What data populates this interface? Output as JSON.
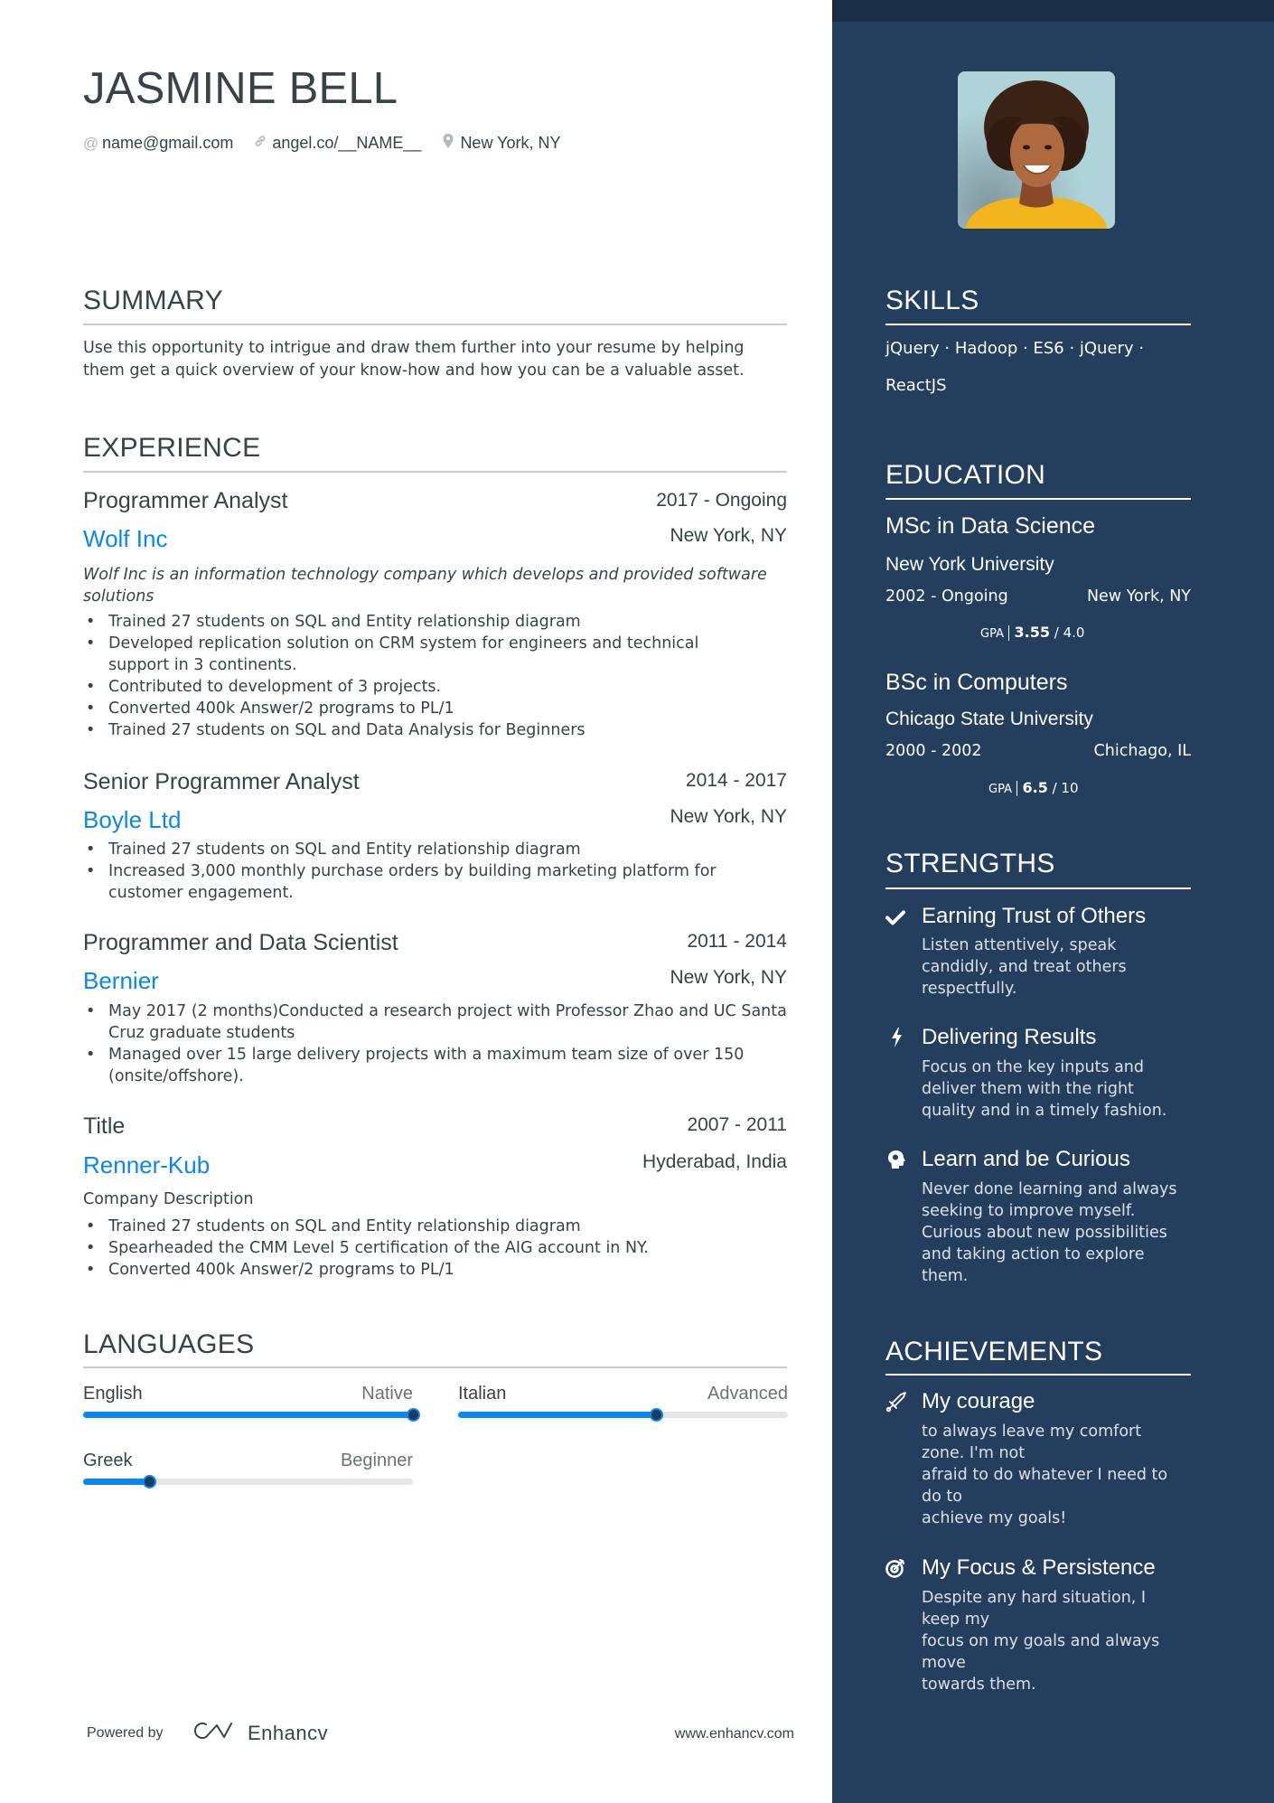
{
  "header": {
    "name": "JASMINE BELL",
    "contacts": [
      {
        "icon": "at-icon",
        "text": "name@gmail.com"
      },
      {
        "icon": "link-icon",
        "text": "angel.co/__NAME__"
      },
      {
        "icon": "location-pin-icon",
        "text": "New York, NY"
      }
    ]
  },
  "summary": {
    "title": "SUMMARY",
    "lines": [
      "Use this opportunity to intrigue and draw them further into your resume by helping",
      "them get a quick overview of your know-how and how you can be a valuable asset."
    ]
  },
  "experience": {
    "title": "EXPERIENCE",
    "jobs": [
      {
        "role": "Programmer Analyst",
        "dates": "2017 - Ongoing",
        "company": "Wolf Inc",
        "location": "New York, NY",
        "description": "Wolf Inc is an information technology company which develops and provided software solutions",
        "bullets": [
          "Trained 27 students on SQL and Entity relationship diagram",
          "Developed replication solution on CRM system for engineers and technical support in 3 continents.",
          "Contributed to development of 3 projects.",
          "Converted 400k Answer/2 programs to PL/1",
          "Trained 27 students on SQL and Data Analysis for Beginners"
        ]
      },
      {
        "role": "Senior Programmer Analyst",
        "dates": "2014 - 2017",
        "company": "Boyle Ltd",
        "location": "New York, NY",
        "bullets": [
          "Trained 27 students on SQL and Entity relationship diagram",
          "Increased 3,000 monthly purchase orders by building marketing platform for customer engagement."
        ]
      },
      {
        "role": "Programmer and Data Scientist",
        "dates": "2011 - 2014",
        "company": "Bernier",
        "location": "New York, NY",
        "bullets": [
          "May 2017 (2 months)Conducted a research project with Professor Zhao and UC Santa Cruz graduate students",
          "Managed over 15 large delivery projects with a maximum team size of over 150 (onsite/offshore)."
        ]
      },
      {
        "role": "Title",
        "dates": "2007 - 2011",
        "company": "Renner-Kub",
        "location": "Hyderabad, India",
        "description": "Company Description",
        "bullets": [
          "Trained 27 students on SQL and Entity relationship diagram",
          "Spearheaded the CMM Level 5 certification of the AIG account in NY.",
          "Converted 400k Answer/2 programs to PL/1"
        ]
      }
    ]
  },
  "languages": {
    "title": "LANGUAGES",
    "items": [
      {
        "name": "English",
        "level": "Native",
        "proficiency": 1.0
      },
      {
        "name": "Italian",
        "level": "Advanced",
        "proficiency": 0.6
      },
      {
        "name": "Greek",
        "level": "Beginner",
        "proficiency": 0.2
      }
    ]
  },
  "footer": {
    "powered_by": "Powered by",
    "brand": "Enhancv",
    "website": "www.enhancv.com"
  },
  "sidebar": {
    "photo_alt": "Profile photo",
    "skills": {
      "title": "SKILLS",
      "line1": "jQuery · Hadoop · ES6 · jQuery ·",
      "line2": "ReactJS",
      "items": [
        "jQuery",
        "Hadoop",
        "ES6",
        "jQuery",
        "ReactJS"
      ]
    },
    "education": {
      "title": "EDUCATION",
      "items": [
        {
          "degree": "MSc in Data Science",
          "school": "New York University",
          "dates": "2002 - Ongoing",
          "location": "New York, NY",
          "gpa_label": "GPA",
          "gpa": "3.55",
          "gpa_max": "/ 4.0"
        },
        {
          "degree": "BSc in Computers",
          "school": "Chicago State University",
          "dates": "2000 - 2002",
          "location": "Chichago, IL",
          "gpa_label": "GPA",
          "gpa": "6.5",
          "gpa_max": "/ 10"
        }
      ]
    },
    "strengths": {
      "title": "STRENGTHS",
      "items": [
        {
          "icon": "checkmark-icon",
          "title": "Earning Trust of Others",
          "lines": [
            "Listen attentively, speak",
            "candidly, and treat others",
            "respectfully."
          ]
        },
        {
          "icon": "lightning-bolt-icon",
          "title": "Delivering Results",
          "lines": [
            "Focus on the key inputs and",
            "deliver them with the right",
            "quality and in a timely fashion."
          ]
        },
        {
          "icon": "head-brain-icon",
          "title": "Learn and be Curious",
          "lines": [
            "Never done learning and always",
            "seeking to improve myself.",
            "Curious about new possibilities",
            "and taking action to explore",
            "them."
          ]
        }
      ]
    },
    "achievements": {
      "title": "ACHIEVEMENTS",
      "items": [
        {
          "icon": "sword-icon",
          "title": "My courage",
          "lines": [
            "to always leave my comfort",
            "zone. I'm not",
            "afraid to do whatever I need to",
            "do to",
            "achieve my goals!"
          ]
        },
        {
          "icon": "target-icon",
          "title": "My Focus & Persistence",
          "lines": [
            "Despite any hard situation, I",
            "keep my",
            "focus on my goals and always",
            "move",
            "towards them."
          ]
        }
      ]
    }
  },
  "colors": {
    "accent": "#0a87ef",
    "sidebar_bg": "#243f5e",
    "sidebar_top": "#1b2d45",
    "text": "#384347"
  }
}
